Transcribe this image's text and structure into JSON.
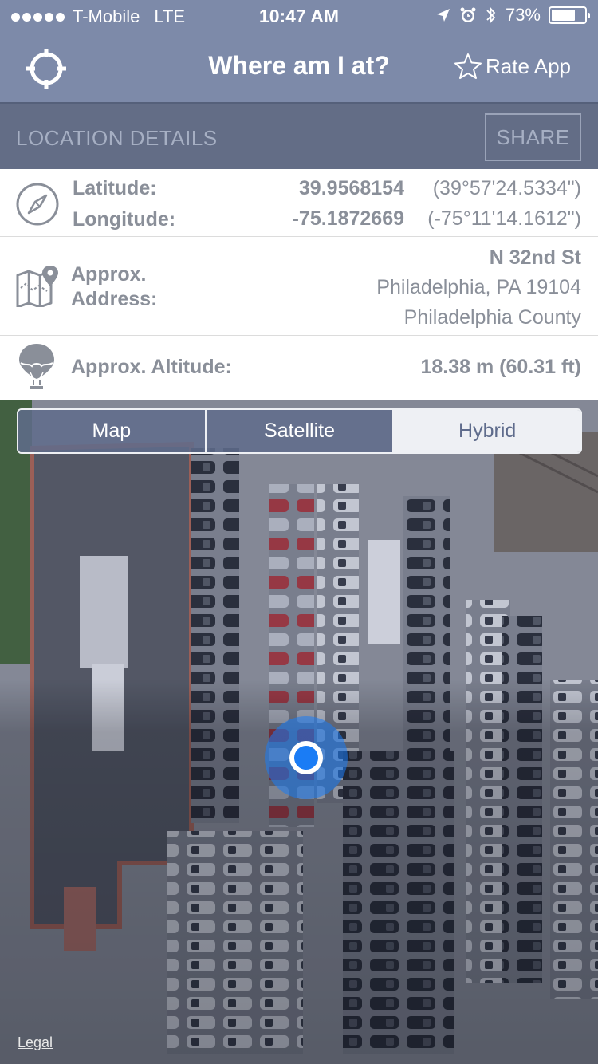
{
  "status_bar": {
    "carrier": "T-Mobile",
    "network": "LTE",
    "time": "10:47 AM",
    "battery_percent": "73%",
    "battery_level": 0.73,
    "icons": [
      "signal-dots-icon",
      "location-arrow-icon",
      "alarm-icon",
      "bluetooth-icon",
      "battery-icon"
    ]
  },
  "nav": {
    "title": "Where am I at?",
    "rate_label": "Rate App",
    "left_icon": "crosshair-icon",
    "rate_icon": "star-icon"
  },
  "section": {
    "title": "LOCATION DETAILS",
    "share_label": "SHARE"
  },
  "coordinates": {
    "icon": "compass-icon",
    "latitude_label": "Latitude:",
    "latitude_value": "39.9568154",
    "latitude_dms": "(39°57'24.5334\")",
    "longitude_label": "Longitude:",
    "longitude_value": "-75.1872669",
    "longitude_dms": "(-75°11'14.1612\")"
  },
  "address": {
    "icon": "map-pin-icon",
    "label_line1": "Approx.",
    "label_line2": "Address:",
    "street": "N 32nd St",
    "city_state_zip": "Philadelphia, PA 19104",
    "county": "Philadelphia County"
  },
  "altitude": {
    "icon": "balloon-icon",
    "label": "Approx. Altitude:",
    "value": "18.38 m (60.31 ft)"
  },
  "map": {
    "segments": [
      "Map",
      "Satellite",
      "Hybrid"
    ],
    "selected_segment": "Hybrid",
    "legal_label": "Legal"
  },
  "colors": {
    "header_bg": "#7d8aa9",
    "section_bg": "#636d86",
    "label_gray": "#8a8f99",
    "location_blue": "#1a7cf5"
  }
}
